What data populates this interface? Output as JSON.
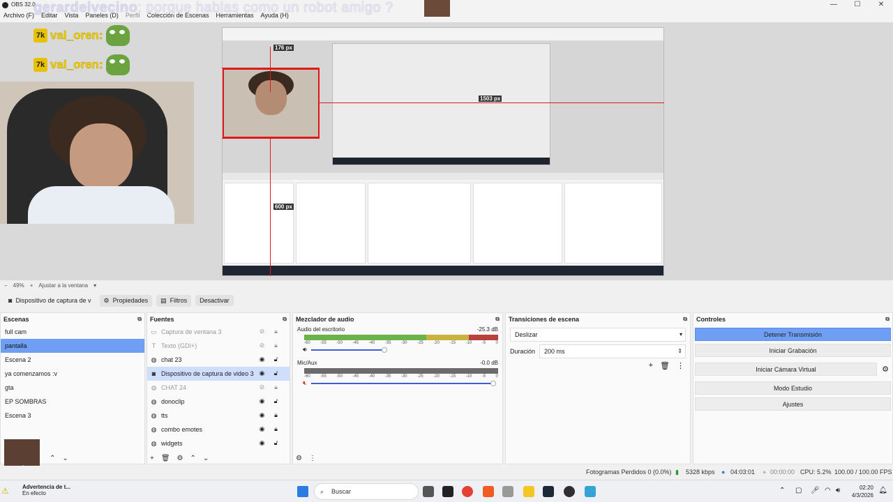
{
  "window": {
    "title": "OBS 32.0",
    "controls": [
      "—",
      "☐",
      "✕"
    ]
  },
  "menu": [
    {
      "label": "Archivo (F)",
      "disabled": false
    },
    {
      "label": "Editar",
      "disabled": false
    },
    {
      "label": "Vista",
      "disabled": false
    },
    {
      "label": "Paneles (D)",
      "disabled": false
    },
    {
      "label": "Perfil",
      "disabled": true
    },
    {
      "label": "Colección de Escenas",
      "disabled": false
    },
    {
      "label": "Herramientas",
      "disabled": false
    },
    {
      "label": "Ayuda (H)",
      "disabled": false
    }
  ],
  "overlay": {
    "chat_user": "gerardelvecino",
    "chat_message": ": porque hablas como un robot amigo ?"
  },
  "preview": {
    "chat_lines": [
      {
        "badge": "7k",
        "name": "val_oren:"
      },
      {
        "badge": "7k",
        "name": "val_oren:"
      }
    ],
    "labels": {
      "top": "176 px",
      "right": "1503 px",
      "left": "600 px"
    }
  },
  "zoom": {
    "minus": "−",
    "level": "49%",
    "plus": "+",
    "fit": "Ajustar a la ventana"
  },
  "source_toolbar": {
    "source_name": "Dispositivo de captura de v",
    "properties": "Propiedades",
    "filters": "Filtros",
    "deactivate": "Desactivar"
  },
  "scenes": {
    "title": "Escenas",
    "items": [
      "full cam",
      "pantalla",
      "Escena 2",
      "ya comenzamos :v",
      "gta",
      "EP SOMBRAS",
      "Escena 3"
    ],
    "selected_index": 1
  },
  "sources": {
    "title": "Fuentes",
    "items": [
      {
        "label": "Captura de ventana 3",
        "icon": "window-icon",
        "visible": false,
        "locked": true
      },
      {
        "label": "Texto (GDI+)",
        "icon": "text-icon",
        "visible": false,
        "locked": true
      },
      {
        "label": "chat 23",
        "icon": "globe-icon",
        "visible": true,
        "locked": false
      },
      {
        "label": "Dispositivo de captura de video 3",
        "icon": "camera-icon",
        "visible": true,
        "locked": false
      },
      {
        "label": "CHAT 24",
        "icon": "globe-icon",
        "visible": false,
        "locked": true
      },
      {
        "label": "donoclip",
        "icon": "globe-icon",
        "visible": true,
        "locked": false
      },
      {
        "label": "tts",
        "icon": "globe-icon",
        "visible": true,
        "locked": true
      },
      {
        "label": "combo emotes",
        "icon": "globe-icon",
        "visible": true,
        "locked": true
      },
      {
        "label": "widgets",
        "icon": "globe-icon",
        "visible": true,
        "locked": false
      }
    ],
    "selected_index": 3
  },
  "mixer": {
    "title": "Mezclador de audio",
    "tracks": [
      {
        "name": "Audio del escritorio",
        "db": "-25.3 dB",
        "level": 0.4,
        "muted": false
      },
      {
        "name": "Mic/Aux",
        "db": "-0.0 dB",
        "level": 0.0,
        "muted": true
      }
    ],
    "scale": [
      "-60",
      "-55",
      "-50",
      "-45",
      "-40",
      "-35",
      "-30",
      "-25",
      "-20",
      "-15",
      "-10",
      "-5",
      "0"
    ]
  },
  "transitions": {
    "title": "Transiciones de escena",
    "selected": "Deslizar",
    "duration_label": "Duración",
    "duration_value": "200 ms"
  },
  "controls": {
    "title": "Controles",
    "buttons": [
      "Detener Transmisión",
      "Iniciar Grabación",
      "Iniciar Cámara Virtual",
      "Modo Estudio",
      "Ajustes"
    ]
  },
  "status": {
    "dropped": "Fotogramas Perdidos 0 (0.0%)",
    "bitrate": "5328 kbps",
    "stream_time": "04:03:01",
    "rec_time": "00:00:00",
    "cpu": "CPU: 5.2%",
    "fps": "100.00 / 100.00 FPS"
  },
  "taskbar": {
    "warning_title": "Advertencia de t...",
    "warning_sub": "En efecto",
    "search": "Buscar",
    "time": "02:20",
    "date": "4/3/2026"
  },
  "colors": {
    "accent": "#6f9ff5",
    "meter_green": "#6ab24a",
    "meter_red": "#b8433e",
    "guide_red": "#e01818"
  }
}
